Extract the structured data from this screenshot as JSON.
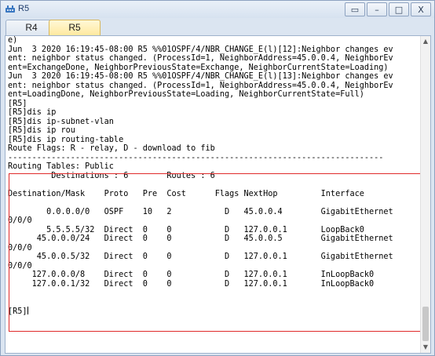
{
  "window": {
    "title": "R5",
    "minimize_glyph": "–",
    "maximize_glyph": "□",
    "close_glyph": "X",
    "restore_glyph": "▭"
  },
  "tabs": [
    {
      "label": "R4",
      "active": false
    },
    {
      "label": "R5",
      "active": true
    }
  ],
  "console": {
    "lines": [
      "e)",
      "Jun  3 2020 16:19:45-08:00 R5 %%01OSPF/4/NBR_CHANGE_E(l)[12]:Neighbor changes ev",
      "ent: neighbor status changed. (ProcessId=1, NeighborAddress=45.0.0.4, NeighborEv",
      "ent=ExchangeDone, NeighborPreviousState=Exchange, NeighborCurrentState=Loading)",
      "Jun  3 2020 16:19:45-08:00 R5 %%01OSPF/4/NBR_CHANGE_E(l)[13]:Neighbor changes ev",
      "ent: neighbor status changed. (ProcessId=1, NeighborAddress=45.0.0.4, NeighborEv",
      "ent=LoadingDone, NeighborPreviousState=Loading, NeighborCurrentState=Full)",
      "[R5]",
      "[R5]dis ip",
      "[R5]dis ip-subnet-vlan",
      "[R5]dis ip rou",
      "[R5]dis ip routing-table",
      "Route Flags: R - relay, D - download to fib",
      "------------------------------------------------------------------------------",
      "Routing Tables: Public",
      "         Destinations : 6        Routes : 6",
      "",
      "Destination/Mask    Proto   Pre  Cost      Flags NextHop         Interface",
      "",
      "        0.0.0.0/0   OSPF    10   2           D   45.0.0.4        GigabitEthernet",
      "0/0/0",
      "        5.5.5.5/32  Direct  0    0           D   127.0.0.1       LoopBack0",
      "      45.0.0.0/24   Direct  0    0           D   45.0.0.5        GigabitEthernet",
      "0/0/0",
      "      45.0.0.5/32   Direct  0    0           D   127.0.0.1       GigabitEthernet",
      "0/0/0",
      "     127.0.0.0/8    Direct  0    0           D   127.0.0.1       InLoopBack0",
      "     127.0.0.1/32   Direct  0    0           D   127.0.0.1       InLoopBack0",
      "",
      "",
      "[R5]"
    ],
    "scroll_up_glyph": "▲",
    "scroll_down_glyph": "▼"
  },
  "colors": {
    "highlight_border": "#e02a2a",
    "active_tab": "#ffe9a0"
  }
}
